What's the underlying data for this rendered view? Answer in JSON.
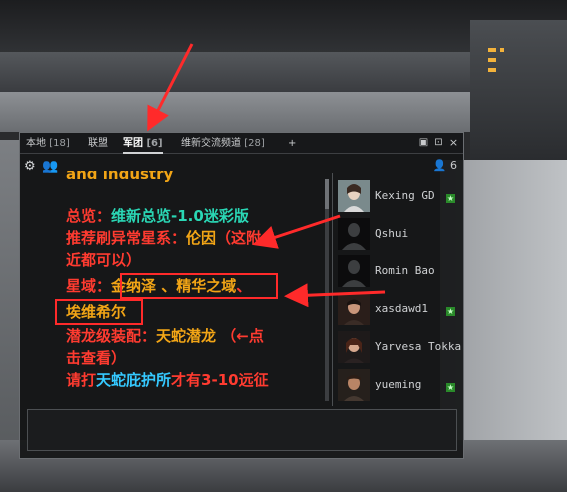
{
  "tabs": [
    {
      "name": "本地",
      "count": "[18]",
      "active": false
    },
    {
      "name": "联盟",
      "count": "",
      "active": false
    },
    {
      "name": "军团",
      "count": "[6]",
      "active": true
    },
    {
      "name": "维新交流频道",
      "count": "[28]",
      "active": false
    },
    {
      "name": "+",
      "count": "",
      "active": false
    }
  ],
  "window_icons": [
    "options-icon",
    "lock-icon",
    "close-icon"
  ],
  "user_count": "6",
  "messages": {
    "partial_top": "and industry",
    "l1_label": "总览：",
    "l1_value": "维新总览-1.0迷彩版",
    "l2_label": "推荐刷异常星系：",
    "l2_value": "伦因",
    "l2_note": "（这附",
    "l3": "近都可以）",
    "l4_label": "星域：",
    "l4_value": "金纳泽 、精华之域",
    "l4_sep": "、",
    "l5": "埃维希尔",
    "l6_label": "潜龙级装配：",
    "l6_value": "天蛇潜龙",
    "l6_note": "（←点",
    "l7": "击查看）",
    "l8_a": "请打",
    "l8_b": "天蛇庇护所",
    "l8_c": "才有3-10远征"
  },
  "members": [
    {
      "name": "Kexing GD",
      "avatar": "portrait-kexing"
    },
    {
      "name": "Qshui",
      "avatar": "silhouette"
    },
    {
      "name": "Romin Bao",
      "avatar": "silhouette"
    },
    {
      "name": "xasdawd1",
      "avatar": "portrait-xasdawd1"
    },
    {
      "name": "Yarvesa Tokka",
      "avatar": "portrait-yarvesa"
    },
    {
      "name": "yueming",
      "avatar": "portrait-yueming"
    }
  ],
  "colors": {
    "red_text": "#ff3b30",
    "gold_text": "#f2a516",
    "teal_text": "#2ad7b5",
    "cyan_text": "#35c9ff",
    "annotation_red": "#ff2a2a",
    "online_green": "#2a8a2a"
  }
}
